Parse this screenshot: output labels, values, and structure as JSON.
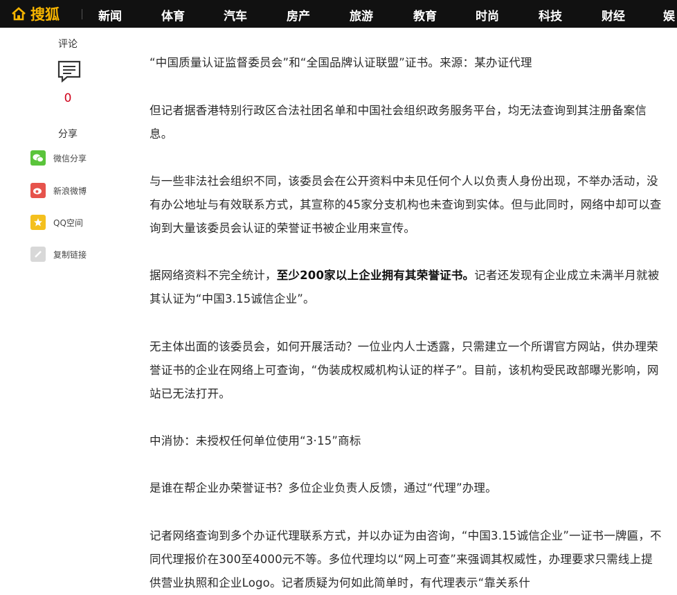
{
  "header": {
    "logo_text": "搜狐",
    "nav": [
      "新闻",
      "体育",
      "汽车",
      "房产",
      "旅游",
      "教育",
      "时尚",
      "科技",
      "财经",
      "娱"
    ]
  },
  "sidebar": {
    "comment_label": "评论",
    "comment_count": "0",
    "share_label": "分享",
    "share_items": [
      {
        "label": "微信分享",
        "icon": "wechat-icon",
        "color": "#5ac43b"
      },
      {
        "label": "新浪微博",
        "icon": "weibo-icon",
        "color": "#e6534c"
      },
      {
        "label": "QQ空间",
        "icon": "qzone-icon",
        "color": "#f4c01e"
      },
      {
        "label": "复制链接",
        "icon": "link-icon",
        "color": "#d8d8d8"
      }
    ]
  },
  "article": {
    "p1": "“中国质量认证监督委员会”和“全国品牌认证联盟”证书。来源：某办证代理",
    "p2": "但记者据香港特别行政区合法社团名单和中国社会组织政务服务平台，均无法查询到其注册备案信息。",
    "p3": "与一些非法社会组织不同，该委员会在公开资料中未见任何个人以负责人身份出现，不举办活动，没有办公地址与有效联系方式，其宣称的45家分支机构也未查询到实体。但与此同时，网络中却可以查询到大量该委员会认证的荣誉证书被企业用来宣传。",
    "p4_pre": "据网络资料不完全统计，",
    "p4_bold": "至少200家以上企业拥有其荣誉证书。",
    "p4_post": "记者还发现有企业成立未满半月就被其认证为“中国3.15诚信企业”。",
    "p5": "无主体出面的该委员会，如何开展活动？一位业内人士透露，只需建立一个所谓官方网站，供办理荣誉证书的企业在网络上可查询，“伪装成权威机构认证的样子”。目前，该机构受民政部曝光影响，网站已无法打开。",
    "p6": "中消协：未授权任何单位使用“3·15”商标",
    "p7": "是谁在帮企业办荣誉证书？多位企业负责人反馈，通过“代理”办理。",
    "p8": "记者网络查询到多个办证代理联系方式，并以办证为由咨询，“中国3.15诚信企业”一证书一牌匾，不同代理报价在300至4000元不等。多位代理均以“网上可查”来强调其权威性，办理要求只需线上提供营业执照和企业Logo。记者质疑为何如此简单时，有代理表示“靠关系什"
  },
  "colors": {
    "topbar": "#111111",
    "logo": "#f7b500",
    "comment_count": "#d0021b"
  }
}
